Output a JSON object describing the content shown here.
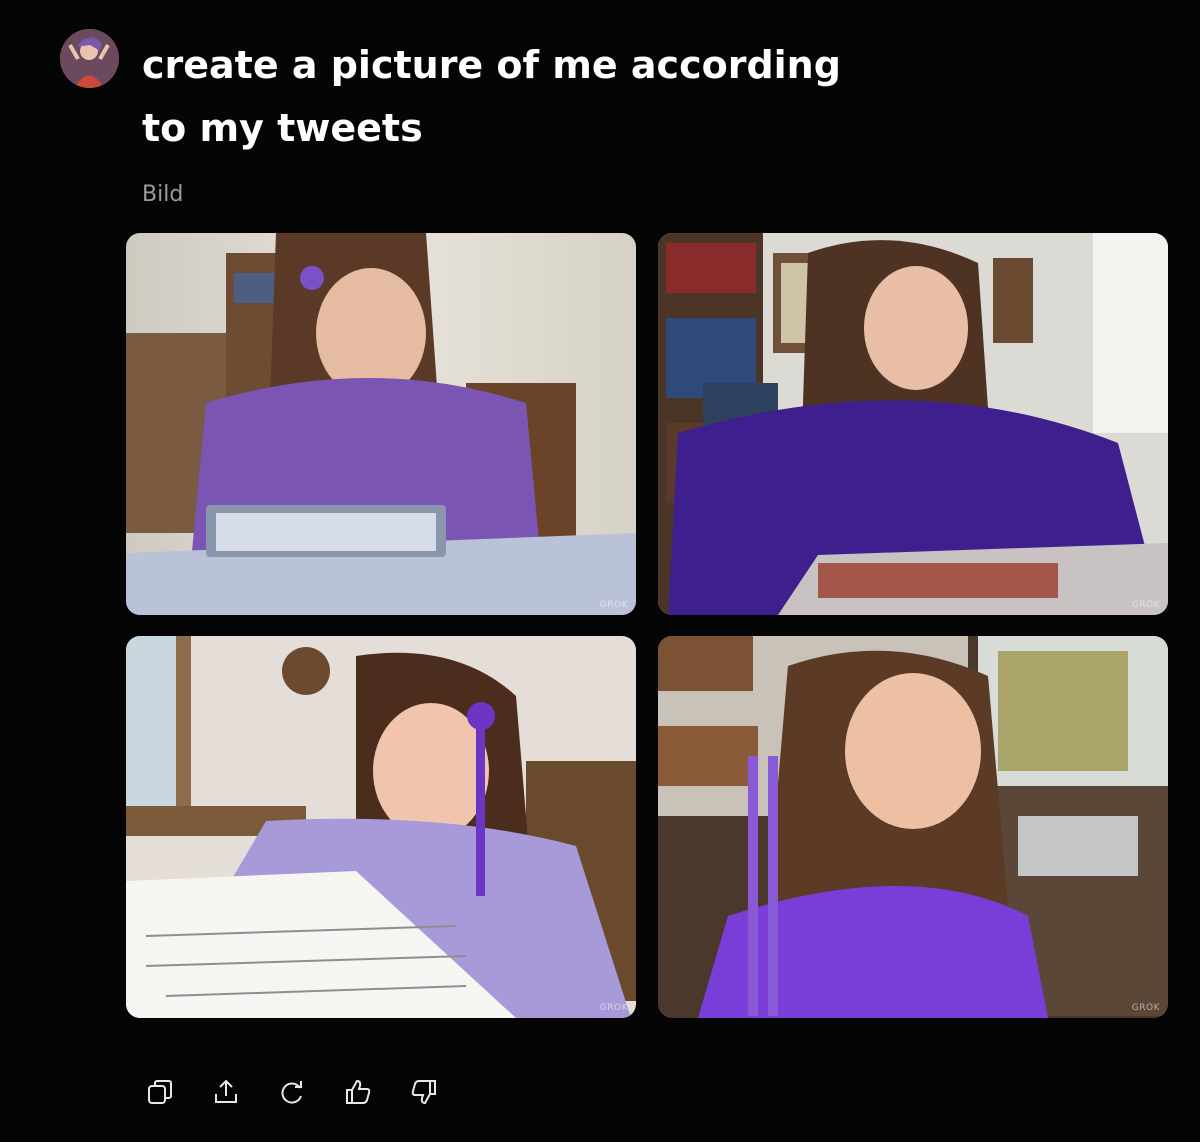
{
  "prompt": {
    "text": "create a picture of me according to my tweets"
  },
  "result": {
    "label": "Bild"
  },
  "images": [
    {
      "watermark": "GROK",
      "description_icon": "photo-woman-reading-comics"
    },
    {
      "watermark": "GROK",
      "description_icon": "photo-woman-purple-sweater"
    },
    {
      "watermark": "GROK",
      "description_icon": "photo-woman-drawing-comics"
    },
    {
      "watermark": "GROK",
      "description_icon": "photo-woman-purple-ribbon"
    }
  ],
  "actions": [
    {
      "name": "copy-icon"
    },
    {
      "name": "share-icon"
    },
    {
      "name": "regenerate-icon"
    },
    {
      "name": "thumbs-up-icon"
    },
    {
      "name": "thumbs-down-icon"
    }
  ],
  "colors": {
    "background": "#050505",
    "text": "#ffffff",
    "muted": "#9a9a9a",
    "accent_purple": "#5b2fa8"
  }
}
